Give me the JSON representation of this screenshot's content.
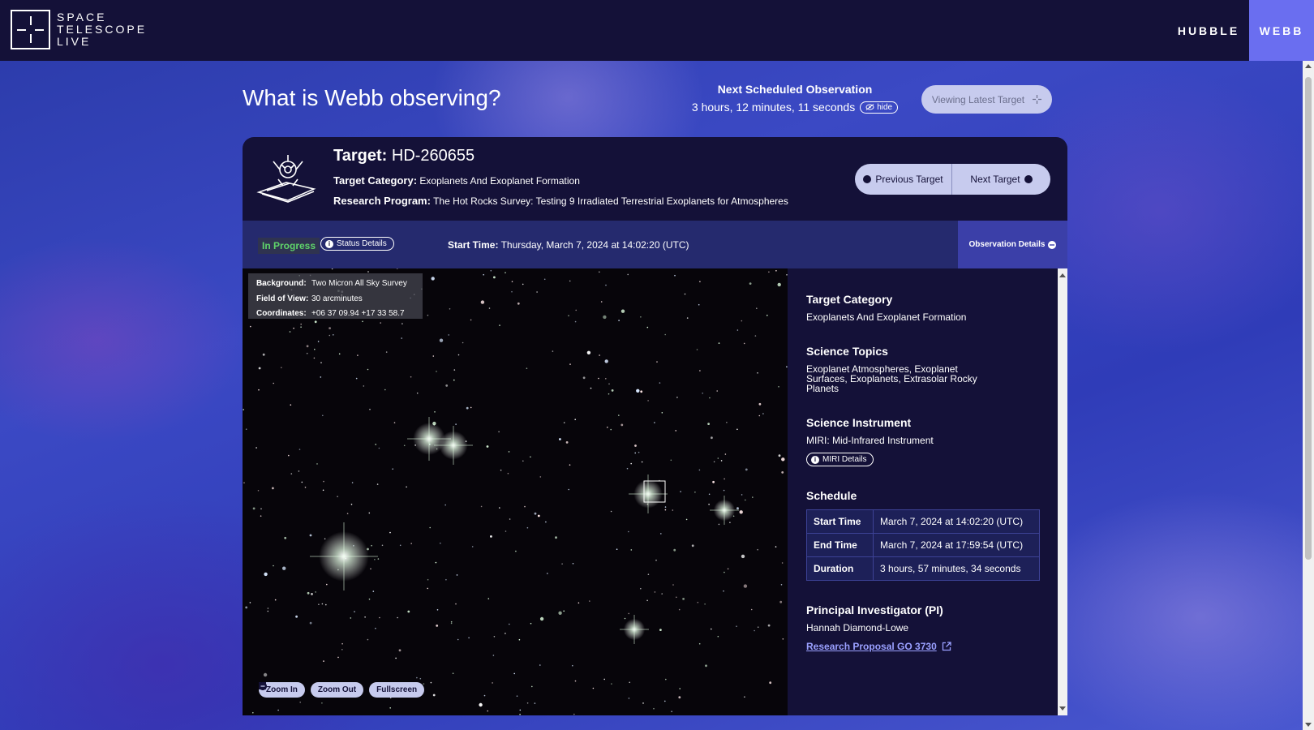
{
  "brand": {
    "line1": "SPACE",
    "line2": "TELESCOPE",
    "line3": "LIVE"
  },
  "nav": {
    "hubble": "HUBBLE",
    "webb": "WEBB"
  },
  "page_title": "What is Webb observing?",
  "next_observation": {
    "label": "Next Scheduled Observation",
    "countdown": "3 hours, 12 minutes, 11 seconds",
    "hide_label": "hide"
  },
  "viewing_button": "Viewing Latest Target",
  "target": {
    "label": "Target:",
    "name": "HD-260655",
    "category_label": "Target Category:",
    "category": "Exoplanets And Exoplanet Formation",
    "program_label": "Research Program:",
    "program": "The Hot Rocks Survey: Testing 9 Irradiated Terrestrial Exoplanets for Atmospheres"
  },
  "nav_buttons": {
    "previous": "Previous Target",
    "next": "Next Target"
  },
  "status": {
    "badge": "In Progress",
    "details_label": "Status Details",
    "start_label": "Start Time:",
    "start_value": "Thursday, March 7, 2024 at 14:02:20 (UTC)",
    "obs_details_label": "Observation Details"
  },
  "sky_info": {
    "background_label": "Background:",
    "background": "Two Micron All Sky Survey",
    "fov_label": "Field of View:",
    "fov": "30 arcminutes",
    "coords_label": "Coordinates:",
    "coords": "+06 37 09.94 +17 33 58.7"
  },
  "zoom": {
    "in": "Zoom In",
    "out": "Zoom Out",
    "fullscreen": "Fullscreen"
  },
  "details": {
    "category_heading": "Target Category",
    "category_value": "Exoplanets And Exoplanet Formation",
    "topics_heading": "Science Topics",
    "topics_value": "Exoplanet Atmospheres, Exoplanet Surfaces, Exoplanets, Extrasolar Rocky Planets",
    "instrument_heading": "Science Instrument",
    "instrument_value": "MIRI: Mid-Infrared Instrument",
    "miri_button": "MIRI Details",
    "schedule_heading": "Schedule",
    "schedule": [
      {
        "key": "Start Time",
        "value": "March 7, 2024 at 14:02:20 (UTC)"
      },
      {
        "key": "End Time",
        "value": "March 7, 2024 at 17:59:54 (UTC)"
      },
      {
        "key": "Duration",
        "value": "3 hours, 57 minutes, 34 seconds"
      }
    ],
    "pi_heading": "Principal Investigator (PI)",
    "pi_value": "Hannah Diamond-Lowe",
    "proposal_link": "Research Proposal GO 3730"
  },
  "colors": {
    "topbar": "#141138",
    "webb_tab": "#6a6ef0",
    "in_progress": "#5fd46a",
    "button_bg": "#c7cbee"
  }
}
